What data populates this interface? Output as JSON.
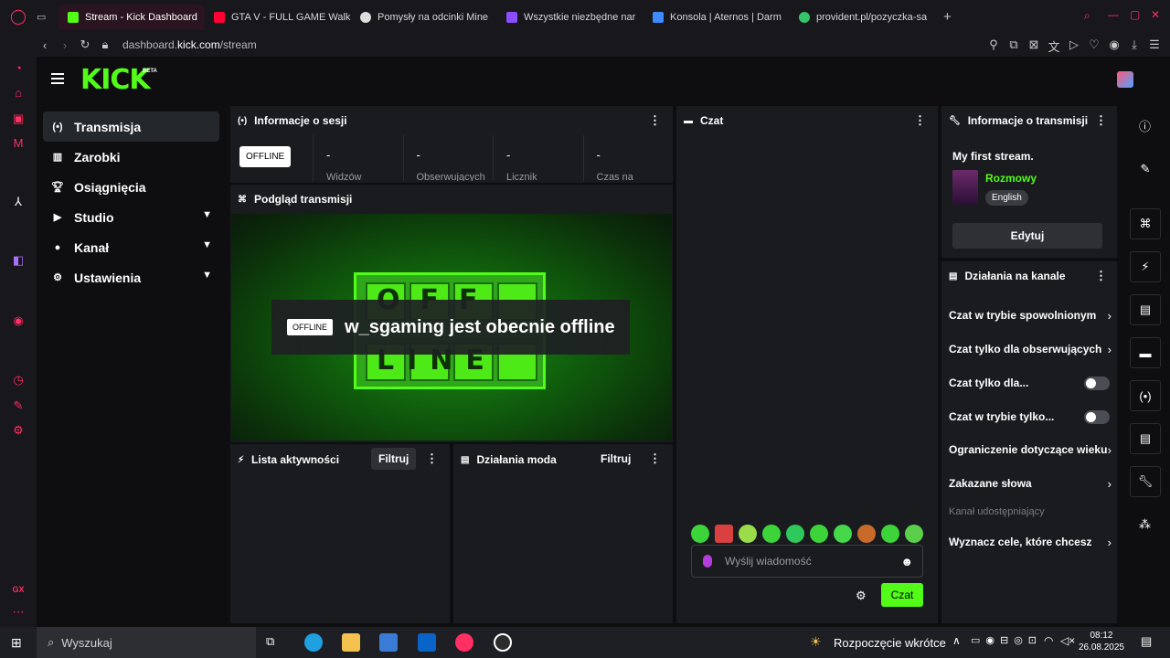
{
  "browser": {
    "tabs": [
      {
        "label": "Stream - Kick Dashboard",
        "color": "#53fc18"
      },
      {
        "label": "GTA V - FULL GAME Walk",
        "color": "#ff0033"
      },
      {
        "label": "Pomysły na odcinki Mine",
        "color": "#dddddd"
      },
      {
        "label": "Wszystkie niezbędne nar",
        "color": "#8a4dff"
      },
      {
        "label": "Konsola | Aternos | Darm",
        "color": "#3d8bff"
      },
      {
        "label": "provident.pl/pozyczka-sa",
        "color": "#35c46a"
      }
    ],
    "url_prefix": "dashboard.",
    "url_domain": "kick.com",
    "url_path": "/stream"
  },
  "header": {
    "logo": "KICK",
    "beta": "BETA"
  },
  "sidebar": {
    "items": [
      {
        "label": "Transmisja",
        "icon": "broadcast-icon"
      },
      {
        "label": "Zarobki",
        "icon": "chart-icon"
      },
      {
        "label": "Osiągnięcia",
        "icon": "trophy-icon"
      },
      {
        "label": "Studio",
        "icon": "play-icon"
      },
      {
        "label": "Kanał",
        "icon": "user-icon"
      },
      {
        "label": "Ustawienia",
        "icon": "gear-icon"
      }
    ]
  },
  "session": {
    "title": "Informacje o sesji",
    "status": "OFFLINE",
    "stats": [
      {
        "value": "-",
        "label": "Widzów"
      },
      {
        "value": "-",
        "label": "Obserwujących"
      },
      {
        "value": "-",
        "label": "Licznik"
      },
      {
        "value": "-",
        "label": "Czas na"
      }
    ]
  },
  "preview": {
    "title": "Podgląd transmisji",
    "overlay_tag": "OFFLINE",
    "overlay_text": "w_sgaming jest obecnie offline",
    "board_top": "OFF",
    "board_bottom": "LINE"
  },
  "activity": {
    "title": "Lista aktywności",
    "filter": "Filtruj"
  },
  "mod_actions": {
    "title": "Działania moda",
    "filter": "Filtruj"
  },
  "chat": {
    "title": "Czat",
    "placeholder": "Wyślij wiadomość",
    "send": "Czat"
  },
  "stream_info": {
    "title": "Informacje o transmisji",
    "stream_title": "My first stream.",
    "category": "Rozmowy",
    "language": "English",
    "edit": "Edytuj"
  },
  "channel_actions": {
    "title": "Działania na kanale",
    "items": [
      {
        "label": "Czat w trybie spowolnionym",
        "control": "arrow"
      },
      {
        "label": "Czat tylko dla obserwujących",
        "control": "arrow"
      },
      {
        "label": "Czat tylko dla...",
        "control": "toggle"
      },
      {
        "label": "Czat w trybie tylko...",
        "control": "toggle"
      },
      {
        "label": "Ograniczenie dotyczące wieku",
        "control": "arrow"
      },
      {
        "label": "Zakazane słowa",
        "control": "arrow"
      },
      {
        "label": "Kanał udostępniający",
        "control": "none"
      },
      {
        "label": "Wyznacz cele, które chcesz",
        "control": "arrow"
      }
    ]
  },
  "taskbar": {
    "search": "Wyszukaj",
    "weather": "Rozpoczęcie wkrótce",
    "time": "08:12",
    "date": "26.08.2025"
  },
  "colors": {
    "accent": "#53fc18",
    "panel": "#191b1f",
    "background": "#0e0e10"
  }
}
